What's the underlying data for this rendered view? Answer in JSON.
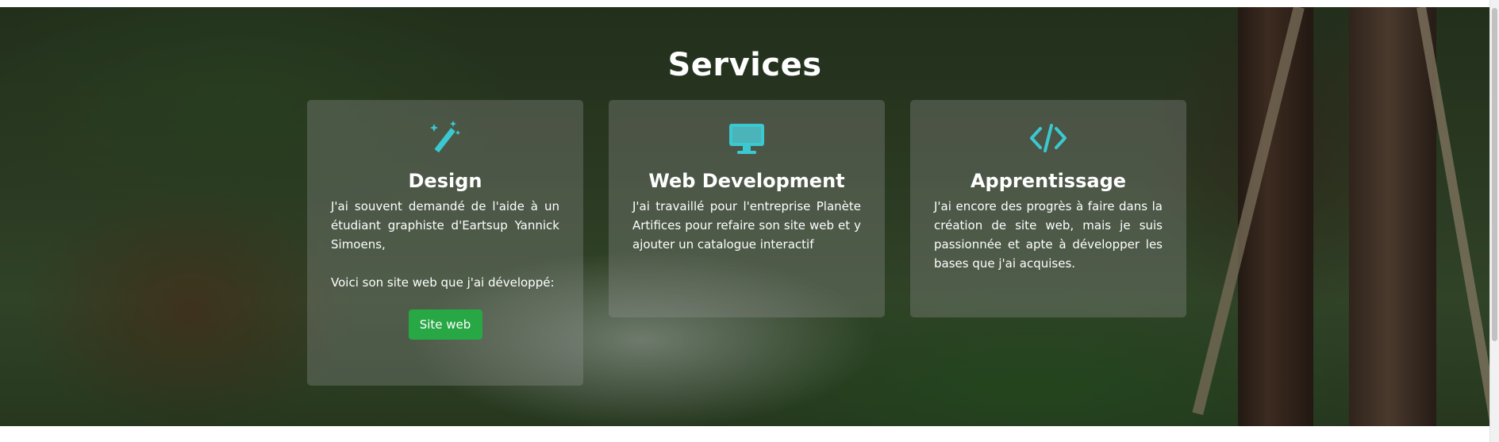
{
  "section": {
    "title": "Services"
  },
  "accent_color": "#3bc8d0",
  "button_color": "#28a745",
  "cards": [
    {
      "icon": "magic-wand-icon",
      "title": "Design",
      "paragraphs": [
        "J'ai souvent demandé de l'aide à un étudiant graphiste d'Eartsup Yannick Simoens,",
        "Voici son site web que j'ai développé:"
      ],
      "button_label": "Site web"
    },
    {
      "icon": "desktop-monitor-icon",
      "title": "Web Development",
      "paragraphs": [
        "J'ai travaillé pour l'entreprise Planète Artifices pour refaire son site web et y ajouter un catalogue interactif"
      ]
    },
    {
      "icon": "code-icon",
      "title": "Apprentissage",
      "paragraphs": [
        "J'ai encore des progrès à faire dans la création de site web, mais je suis passionnée et apte à développer les bases que j'ai acquises."
      ]
    }
  ]
}
